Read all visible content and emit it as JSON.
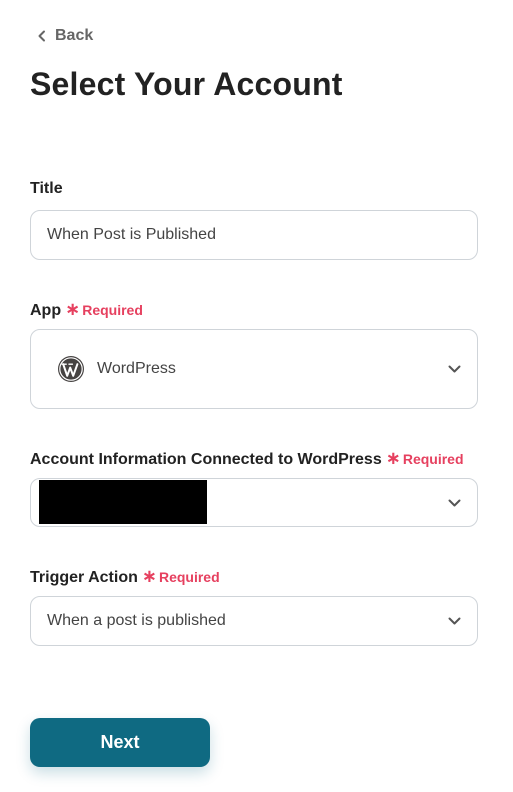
{
  "back": {
    "label": "Back",
    "icon": "chevron-left-icon"
  },
  "page_title": "Select Your Account",
  "fields": {
    "title": {
      "label": "Title",
      "value": "When Post is Published"
    },
    "app": {
      "label": "App",
      "required_label": "Required",
      "value": "WordPress",
      "icon": "wordpress-logo-icon"
    },
    "account": {
      "label": "Account Information Connected to WordPress",
      "required_label": "Required",
      "value": ""
    },
    "trigger": {
      "label": "Trigger Action",
      "required_label": "Required",
      "value": "When a post is published"
    }
  },
  "next_button": {
    "label": "Next"
  },
  "colors": {
    "accent": "#0f6a82",
    "required": "#e6405f",
    "border": "#cfd4d9",
    "text": "#222222",
    "muted": "#666666"
  }
}
